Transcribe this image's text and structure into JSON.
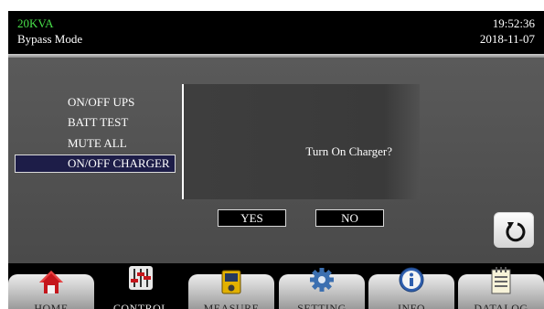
{
  "header": {
    "model": "20KVA",
    "mode": "Bypass Mode",
    "time": "19:52:36",
    "date": "2018-11-07"
  },
  "menu": {
    "items": [
      {
        "label": "ON/OFF UPS"
      },
      {
        "label": "BATT TEST"
      },
      {
        "label": "MUTE ALL"
      },
      {
        "label": "ON/OFF CHARGER",
        "selected": true
      }
    ]
  },
  "dialog": {
    "message": "Turn On Charger?",
    "yes_label": "YES",
    "no_label": "NO"
  },
  "back_button": {
    "icon": "refresh-icon"
  },
  "tabs": [
    {
      "label": "HOME",
      "icon": "home-icon",
      "active": false
    },
    {
      "label": "CONTROL",
      "icon": "control-sliders-icon",
      "active": true
    },
    {
      "label": "MEASURE",
      "icon": "meter-icon",
      "active": false
    },
    {
      "label": "SETTING",
      "icon": "gear-icon",
      "active": false
    },
    {
      "label": "INFO",
      "icon": "info-icon",
      "active": false
    },
    {
      "label": "DATALOG",
      "icon": "log-notepad-icon",
      "active": false
    }
  ],
  "colors": {
    "model_text": "#49e04a",
    "selected_item_bg": "#1d1d48",
    "content_bg": "#4a4a4a"
  }
}
